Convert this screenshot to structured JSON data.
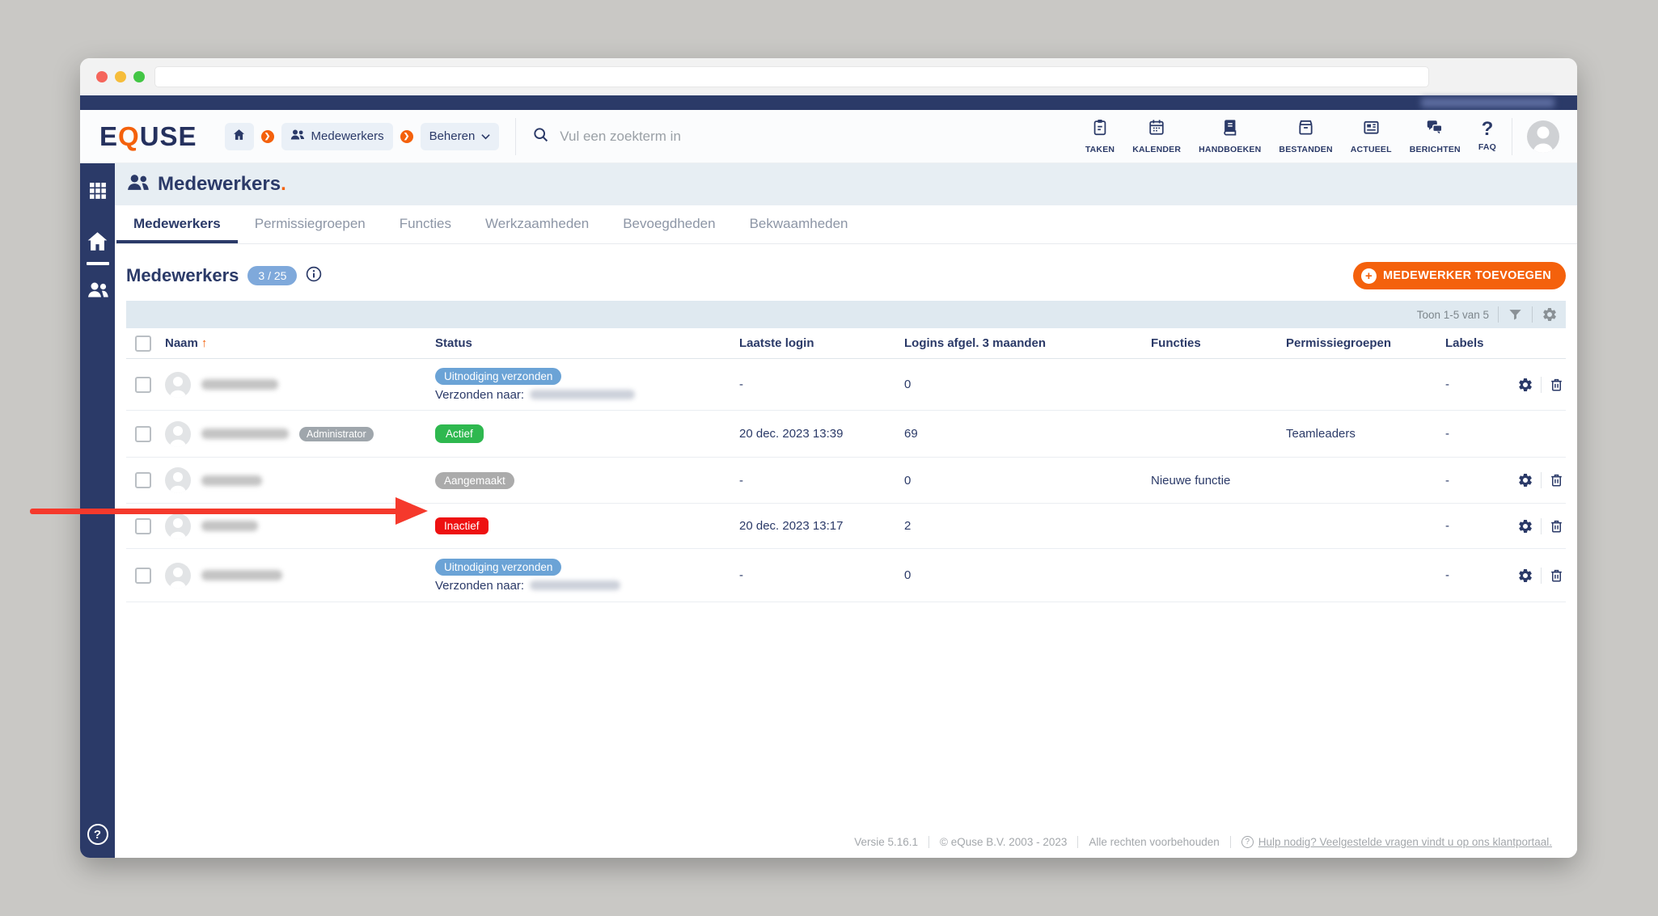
{
  "header": {
    "logo_e": "E",
    "logo_q": "Q",
    "logo_use": "USE",
    "breadcrumb": {
      "medewerkers_label": "Medewerkers",
      "beheren_label": "Beheren"
    },
    "search_placeholder": "Vul een zoekterm in",
    "nav_items": [
      {
        "icon": "clipboard-icon",
        "label": "TAKEN"
      },
      {
        "icon": "calendar-icon",
        "label": "KALENDER"
      },
      {
        "icon": "book-icon",
        "label": "HANDBOEKEN"
      },
      {
        "icon": "archive-icon",
        "label": "BESTANDEN"
      },
      {
        "icon": "newspaper-icon",
        "label": "ACTUEEL"
      },
      {
        "icon": "chat-icon",
        "label": "BERICHTEN"
      },
      {
        "icon": "question-icon",
        "label": "FAQ"
      }
    ]
  },
  "page": {
    "title": "Medewerkers",
    "title_suffix": ".",
    "tabs": [
      {
        "label": "Medewerkers",
        "active": true
      },
      {
        "label": "Permissiegroepen",
        "active": false
      },
      {
        "label": "Functies",
        "active": false
      },
      {
        "label": "Werkzaamheden",
        "active": false
      },
      {
        "label": "Bevoegdheden",
        "active": false
      },
      {
        "label": "Bekwaamheden",
        "active": false
      }
    ],
    "section_title": "Medewerkers",
    "count_badge": "3 / 25",
    "add_button_label": "MEDEWERKER TOEVOEGEN",
    "pagination_text": "Toon 1-5 van 5"
  },
  "table": {
    "columns": {
      "naam": "Naam",
      "status": "Status",
      "laatste_login": "Laatste login",
      "logins": "Logins afgel. 3 maanden",
      "functies": "Functies",
      "permissiegroepen": "Permissiegroepen",
      "labels": "Labels"
    },
    "sort_arrow": "↑",
    "rows": [
      {
        "status": "Uitnodiging verzonden",
        "status_type": "blue",
        "sub_label": "Verzonden naar:",
        "laatste_login": "-",
        "logins": "0",
        "functies": "",
        "permissiegroepen": "",
        "labels": "-"
      },
      {
        "role_badge": "Administrator",
        "status": "Actief",
        "status_type": "green",
        "laatste_login": "20 dec. 2023 13:39",
        "logins": "69",
        "functies": "",
        "permissiegroepen": "Teamleaders",
        "labels": "-"
      },
      {
        "status": "Aangemaakt",
        "status_type": "gray",
        "laatste_login": "-",
        "logins": "0",
        "functies": "Nieuwe functie",
        "permissiegroepen": "",
        "labels": "-"
      },
      {
        "status": "Inactief",
        "status_type": "red",
        "laatste_login": "20 dec. 2023 13:17",
        "logins": "2",
        "functies": "",
        "permissiegroepen": "",
        "labels": "-"
      },
      {
        "status": "Uitnodiging verzonden",
        "status_type": "blue",
        "sub_label": "Verzonden naar:",
        "laatste_login": "-",
        "logins": "0",
        "functies": "",
        "permissiegroepen": "",
        "labels": "-"
      }
    ]
  },
  "footer": {
    "version": "Versie 5.16.1",
    "copyright": "© eQuse B.V. 2003 - 2023",
    "rights": "Alle rechten voorbehouden",
    "help_link": "Hulp nodig? Veelgestelde vragen vindt u op ons klantportaal."
  },
  "colors": {
    "navy": "#2b3a68",
    "accent_orange": "#f4610c",
    "badge_blue": "#6ba3d6",
    "badge_green": "#2eb84f",
    "badge_red": "#ee1111",
    "badge_gray": "#ababab",
    "arrow_red": "#f5392c"
  }
}
